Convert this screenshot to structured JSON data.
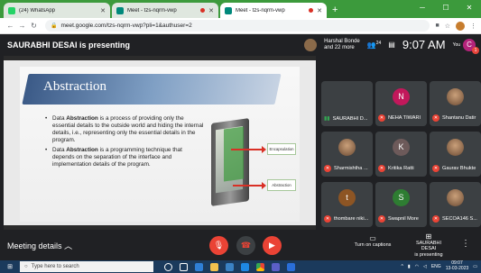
{
  "browser": {
    "tabs": [
      {
        "label": "(24) WhatsApp",
        "icon": "whatsapp-icon",
        "active": false
      },
      {
        "label": "Meet - tzs-nqrm-vwp",
        "icon": "meet-icon",
        "active": false,
        "recording": true
      },
      {
        "label": "Meet - tzs-nqrm-vwp",
        "icon": "meet-icon",
        "active": true,
        "recording": true
      }
    ],
    "new_tab": "+",
    "url": "meet.google.com/tzs-nqrm-vwp?pli=1&authuser=2",
    "tabstrip_color": "#3c9a3c"
  },
  "meet": {
    "presenting_title": "SAURABHI DESAI is presenting",
    "host_line1": "Harshal Bonde",
    "host_line2": "and 22 more",
    "people_count": "24",
    "clock": "9:07 AM",
    "you_label": "You",
    "you_initial": "C",
    "you_badge": "1"
  },
  "slide": {
    "title": "Abstraction",
    "bullets": [
      {
        "pre": "Data ",
        "bold": "Abstraction",
        "post": " is a process of providing only the essential details to the outside world and hiding the internal details, i.e., representing only the essential details in the program."
      },
      {
        "pre": "Data ",
        "bold": "Abstraction",
        "post": " is a programming technique that depends on the separation of the interface and implementation details of the program."
      }
    ],
    "label_encapsulation": "Encapsulation",
    "label_abstraction": "Abstraction"
  },
  "participants": [
    {
      "name": "SAURABHI D...",
      "initial": "",
      "color": "#202124",
      "speaking": true,
      "muted": false,
      "photo": false
    },
    {
      "name": "NEHA TIWARI",
      "initial": "N",
      "color": "#c2185b",
      "speaking": false,
      "muted": true,
      "photo": false
    },
    {
      "name": "Shantanu Datir",
      "initial": "",
      "color": "#6b4a33",
      "speaking": false,
      "muted": true,
      "photo": true
    },
    {
      "name": "Sharmishtha ...",
      "initial": "",
      "color": "#8a5a2b",
      "speaking": false,
      "muted": true,
      "photo": true
    },
    {
      "name": "Kritika Ratti",
      "initial": "K",
      "color": "#6d5a5a",
      "speaking": false,
      "muted": true,
      "photo": false
    },
    {
      "name": "Gaurav Bhukte",
      "initial": "",
      "color": "#6b4a33",
      "speaking": false,
      "muted": true,
      "photo": true
    },
    {
      "name": "thombare niki...",
      "initial": "t",
      "color": "#8d5524",
      "speaking": false,
      "muted": true,
      "photo": false
    },
    {
      "name": "Swapnil More",
      "initial": "S",
      "color": "#2e7d32",
      "speaking": false,
      "muted": true,
      "photo": false
    },
    {
      "name": "SECOA146 S...",
      "initial": "",
      "color": "#6b4a33",
      "speaking": false,
      "muted": true,
      "photo": true
    }
  ],
  "bottombar": {
    "meeting_details": "Meeting details",
    "captions": "Turn on captions",
    "presenter_line1": "SAURABHI DESAI",
    "presenter_line2": "is presenting"
  },
  "taskbar": {
    "search_placeholder": "Type here to search",
    "lang": "ENG",
    "time": "09:07",
    "date": "13-03-2023"
  }
}
